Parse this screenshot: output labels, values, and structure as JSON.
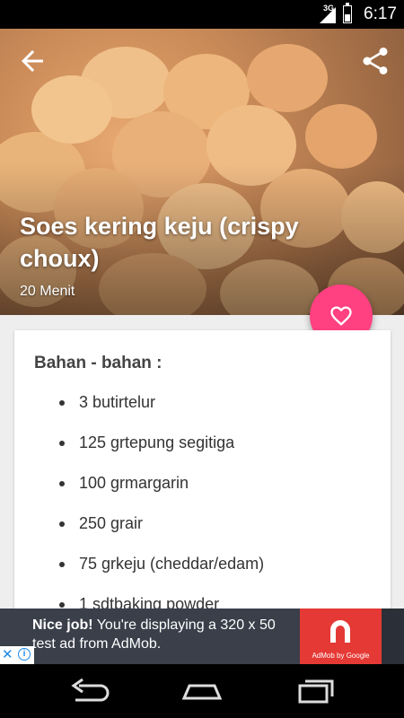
{
  "status_bar": {
    "network": "3G",
    "time": "6:17"
  },
  "recipe": {
    "title": "Soes kering keju (crispy choux)",
    "time": "20 Menit"
  },
  "ingredients": {
    "heading": "Bahan - bahan :",
    "items": [
      "3 butirtelur",
      "125 grtepung segitiga",
      "100 grmargarin",
      "250 grair",
      "75 grkeju (cheddar/edam)",
      "1 sdtbaking powder"
    ]
  },
  "ad": {
    "bold_text": "Nice job!",
    "text": " You're displaying a 320 x 50 test ad from AdMob.",
    "logo_caption": "AdMob by Google",
    "close_glyph": "✕",
    "info_glyph": "i"
  },
  "colors": {
    "accent": "#ff4081",
    "ad_background": "#3a3f4a",
    "admob_red": "#e53935"
  },
  "icons": {
    "back": "arrow-back-icon",
    "share": "share-icon",
    "favorite": "heart-outline-icon",
    "nav_back": "nav-back-icon",
    "nav_home": "nav-home-icon",
    "nav_recent": "nav-recent-icon"
  }
}
